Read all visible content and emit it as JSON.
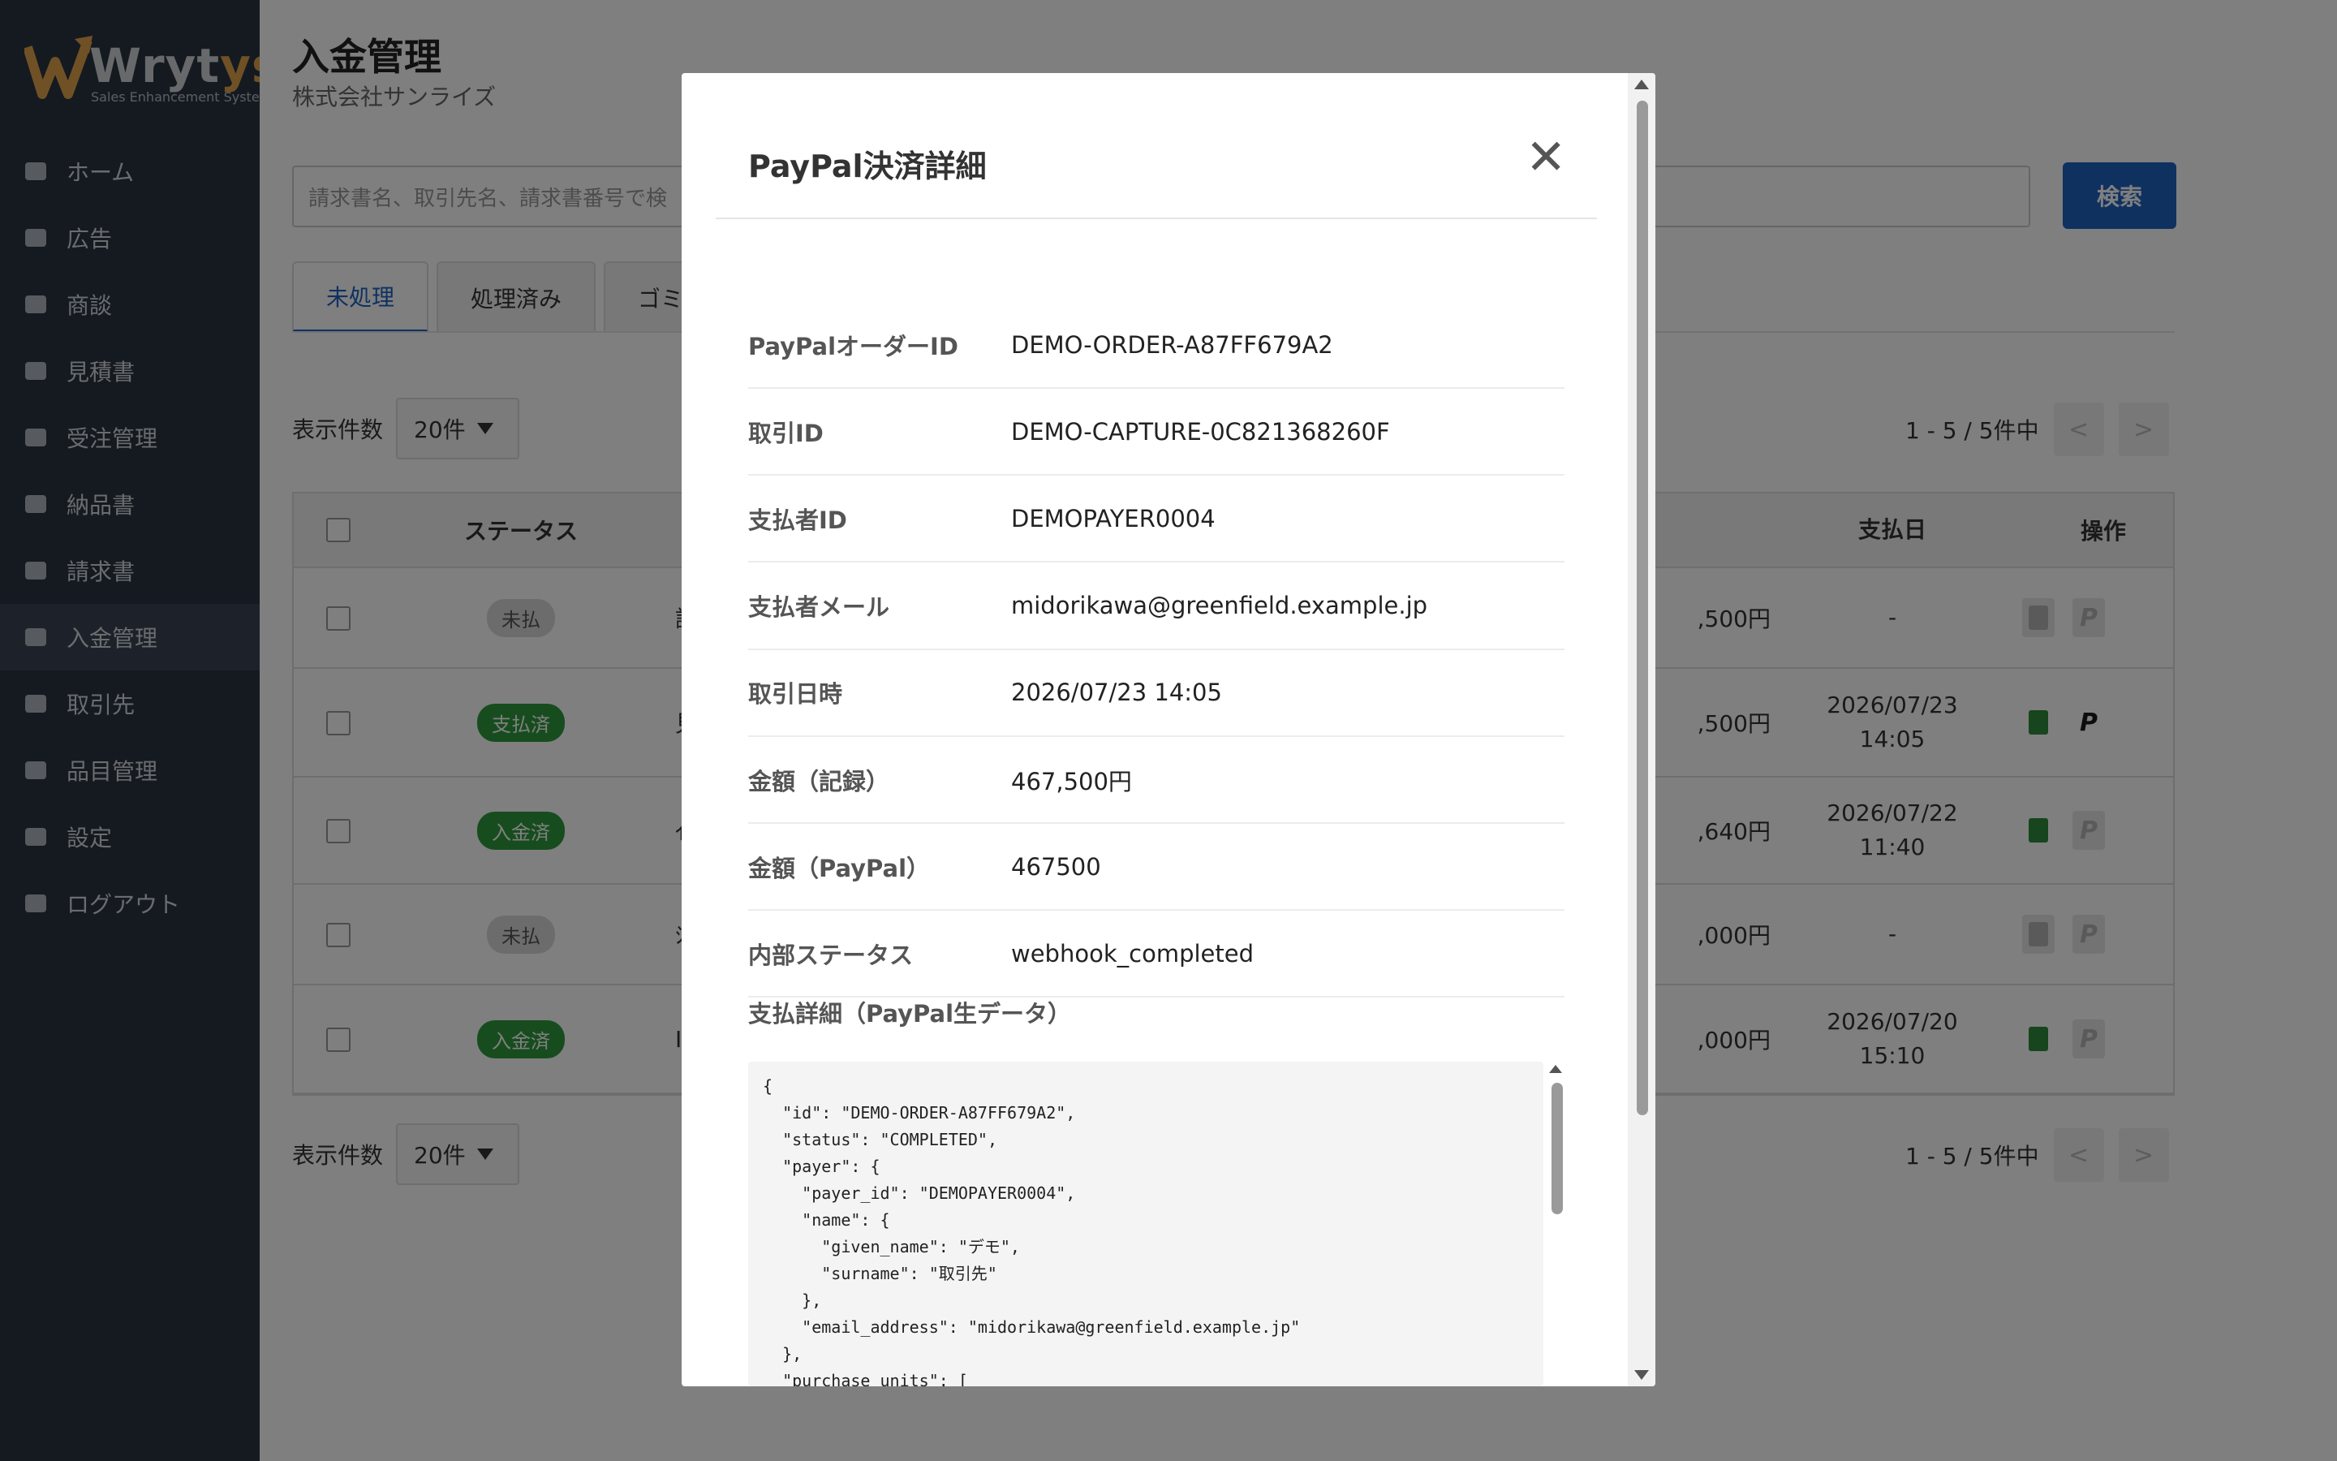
{
  "brand": {
    "logo_mark": "W",
    "name_main": "Wryt",
    "name_accent": "ys",
    "subtitle": "Sales Enhancement System"
  },
  "nav": [
    {
      "label": "ホーム",
      "icon": "home-icon"
    },
    {
      "label": "広告",
      "icon": "ad-icon"
    },
    {
      "label": "商談",
      "icon": "handshake-icon"
    },
    {
      "label": "見積書",
      "icon": "document-icon"
    },
    {
      "label": "受注管理",
      "icon": "clipboard-check-icon"
    },
    {
      "label": "納品書",
      "icon": "truck-icon"
    },
    {
      "label": "請求書",
      "icon": "invoice-icon"
    },
    {
      "label": "入金管理",
      "icon": "money-icon",
      "active": true
    },
    {
      "label": "取引先",
      "icon": "users-icon"
    },
    {
      "label": "品目管理",
      "icon": "boxes-icon"
    },
    {
      "label": "設定",
      "icon": "gear-icon"
    },
    {
      "label": "ログアウト",
      "icon": "logout-icon"
    }
  ],
  "page": {
    "title": "入金管理",
    "company": "株式会社サンライズ"
  },
  "search": {
    "placeholder": "請求書名、取引先名、請求書番号で検",
    "button": "検索"
  },
  "tabs": [
    "未処理",
    "処理済み",
    "ゴミ"
  ],
  "list": {
    "per_page_label": "表示件数",
    "per_page_value": "20件",
    "count_text": "1 - 5 / 5件中",
    "prev": "<",
    "next": ">"
  },
  "table": {
    "headers": {
      "status": "ステータス",
      "pay_date": "支払日",
      "actions": "操作"
    },
    "rows": [
      {
        "status": "未払",
        "status_color": "gray",
        "name": "請",
        "amount": ",500円",
        "date": "-",
        "time": "",
        "paypal_active": false,
        "receipt_active": false
      },
      {
        "status": "支払済",
        "status_color": "green",
        "name": "見",
        "amount": ",500円",
        "date": "2026/07/23",
        "time": "14:05",
        "paypal_active": true,
        "receipt_active": true
      },
      {
        "status": "入金済",
        "status_color": "green",
        "name": "ｲ",
        "amount": ",640円",
        "date": "2026/07/22",
        "time": "11:40",
        "paypal_active": false,
        "receipt_active": true
      },
      {
        "status": "未払",
        "status_color": "gray",
        "name": "ｼ",
        "amount": ",000円",
        "date": "-",
        "time": "",
        "paypal_active": false,
        "receipt_active": false
      },
      {
        "status": "入金済",
        "status_color": "green",
        "name": "I",
        "amount": ",000円",
        "date": "2026/07/20",
        "time": "15:10",
        "paypal_active": false,
        "receipt_active": true
      }
    ]
  },
  "modal": {
    "title": "PayPal決済詳細",
    "close_glyph": "✕",
    "rows": [
      {
        "label": "PayPalオーダーID",
        "value": "DEMO-ORDER-A87FF679A2"
      },
      {
        "label": "取引ID",
        "value": "DEMO-CAPTURE-0C821368260F"
      },
      {
        "label": "支払者ID",
        "value": "DEMOPAYER0004"
      },
      {
        "label": "支払者メール",
        "value": "midorikawa@greenfield.example.jp"
      },
      {
        "label": "取引日時",
        "value": "2026/07/23 14:05"
      },
      {
        "label": "金額（記録）",
        "value": "467,500円"
      },
      {
        "label": "金額（PayPal）",
        "value": "467500"
      },
      {
        "label": "内部ステータス",
        "value": "webhook_completed"
      }
    ],
    "raw_title": "支払詳細（PayPal生データ）",
    "raw_json": "{\n  \"id\": \"DEMO-ORDER-A87FF679A2\",\n  \"status\": \"COMPLETED\",\n  \"payer\": {\n    \"payer_id\": \"DEMOPAYER0004\",\n    \"name\": {\n      \"given_name\": \"デモ\",\n      \"surname\": \"取引先\"\n    },\n    \"email_address\": \"midorikawa@greenfield.example.jp\"\n  },\n  \"purchase_units\": ["
  },
  "colors": {
    "sidebar": "#2b3442",
    "primary": "#1e63c0",
    "paid": "#2e9b3c",
    "unpaid": "#d9d9d9",
    "receipt": "#2e8b3c",
    "paypal": "#1a1a1a"
  }
}
